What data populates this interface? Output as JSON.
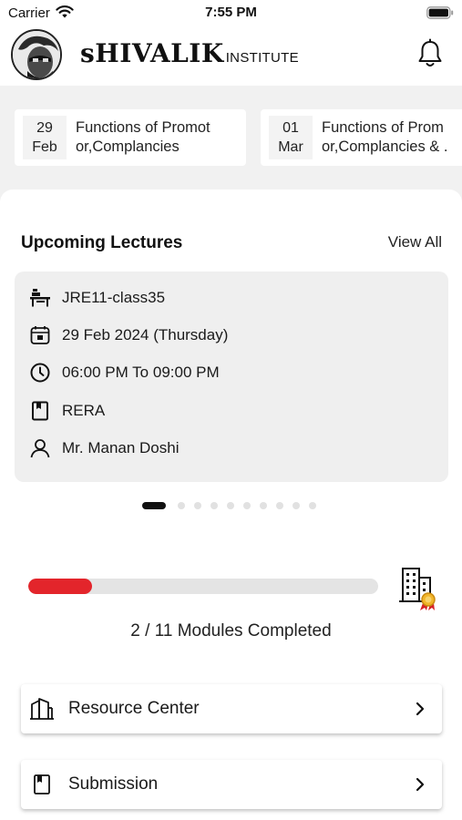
{
  "status_bar": {
    "carrier": "Carrier",
    "time": "7:55 PM"
  },
  "header": {
    "logo_main": "sHIVALIK",
    "logo_sub": "INSTITUTE"
  },
  "news": [
    {
      "day": "29",
      "month": "Feb",
      "line1": "Functions of Promot",
      "line2": "or,Complancies"
    },
    {
      "day": "01",
      "month": "Mar",
      "line1": "Functions of Prom",
      "line2": "or,Complancies & ."
    }
  ],
  "upcoming": {
    "title": "Upcoming Lectures",
    "view_all": "View All",
    "lecture": {
      "class": "JRE11-class35",
      "date": "29 Feb 2024 (Thursday)",
      "time": "06:00 PM To 09:00 PM",
      "subject": "RERA",
      "teacher": "Mr. Manan  Doshi"
    },
    "carousel_count": 10,
    "carousel_active": 0
  },
  "progress": {
    "completed": 2,
    "total": 11,
    "label": "2 / 11 Modules Completed",
    "fill_color": "#e3252b"
  },
  "menu": [
    {
      "label": "Resource Center",
      "icon": "building-icon"
    },
    {
      "label": "Submission",
      "icon": "bookmark-icon"
    }
  ]
}
